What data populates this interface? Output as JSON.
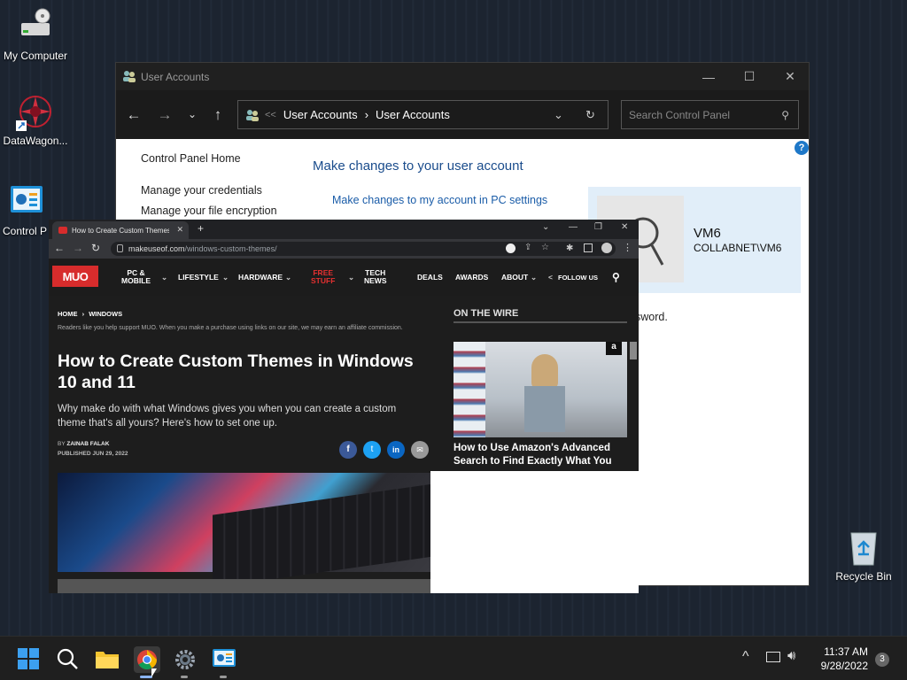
{
  "desktop": {
    "icons": [
      {
        "label": "My Computer",
        "icon": "computer-icon"
      },
      {
        "label": "DataWagon...",
        "icon": "datawagon-icon"
      },
      {
        "label": "Control P",
        "icon": "control-panel-icon"
      },
      {
        "label": "Recycle Bin",
        "icon": "recycle-bin-icon"
      }
    ]
  },
  "control_panel": {
    "title": "User Accounts",
    "address": {
      "crumb1": "User Accounts",
      "crumb2": "User Accounts",
      "chev": "<<"
    },
    "search_placeholder": "Search Control Panel",
    "side_links": [
      "Control Panel Home",
      "Manage your credentials",
      "Manage your file encryption"
    ],
    "heading": "Make changes to your user account",
    "link_pc_settings": "Make changes to my account in PC settings",
    "user_name": "VM6",
    "user_domain": "COLLABNET\\VM6",
    "partial_text": "sword.",
    "help_label": "?"
  },
  "chrome": {
    "tab_title": "How to Create Custom Themes i",
    "url_domain": "makeuseof.com",
    "url_path": "/windows-custom-themes/",
    "site": {
      "logo": "MUO",
      "nav": [
        "PC & MOBILE",
        "LIFESTYLE",
        "HARDWARE",
        "FREE STUFF",
        "TECH NEWS",
        "DEALS",
        "AWARDS",
        "ABOUT",
        "FOLLOW US"
      ],
      "nav_pc_line1": "PC &",
      "nav_pc_line2": "MOBILE",
      "nav_free_line1": "FREE",
      "nav_free_line2": "STUFF",
      "nav_tech_line1": "TECH",
      "nav_tech_line2": "NEWS"
    },
    "article": {
      "breadcrumb_home": "HOME",
      "breadcrumb_section": "WINDOWS",
      "disclaimer": "Readers like you help support MUO. When you make a purchase using links on our site, we may earn an affiliate commission.",
      "title": "How to Create Custom Themes in Windows 10 and 11",
      "subtitle": "Why make do with what Windows gives you when you can create a custom theme that's all yours? Here's how to set one up.",
      "byline_prefix": "BY",
      "author": "ZAINAB FALAK",
      "published": "PUBLISHED JUN 29, 2022"
    },
    "sidebar": {
      "heading": "ON THE WIRE",
      "card_title": "How to Use Amazon's Advanced Search to Find Exactly What You W..."
    }
  },
  "taskbar": {
    "time": "11:37 AM",
    "date": "9/28/2022",
    "notifications": "3"
  },
  "colors": {
    "accent_red": "#d72c2c",
    "link_blue": "#1a5ca8",
    "user_panel": "#e1eef9"
  }
}
